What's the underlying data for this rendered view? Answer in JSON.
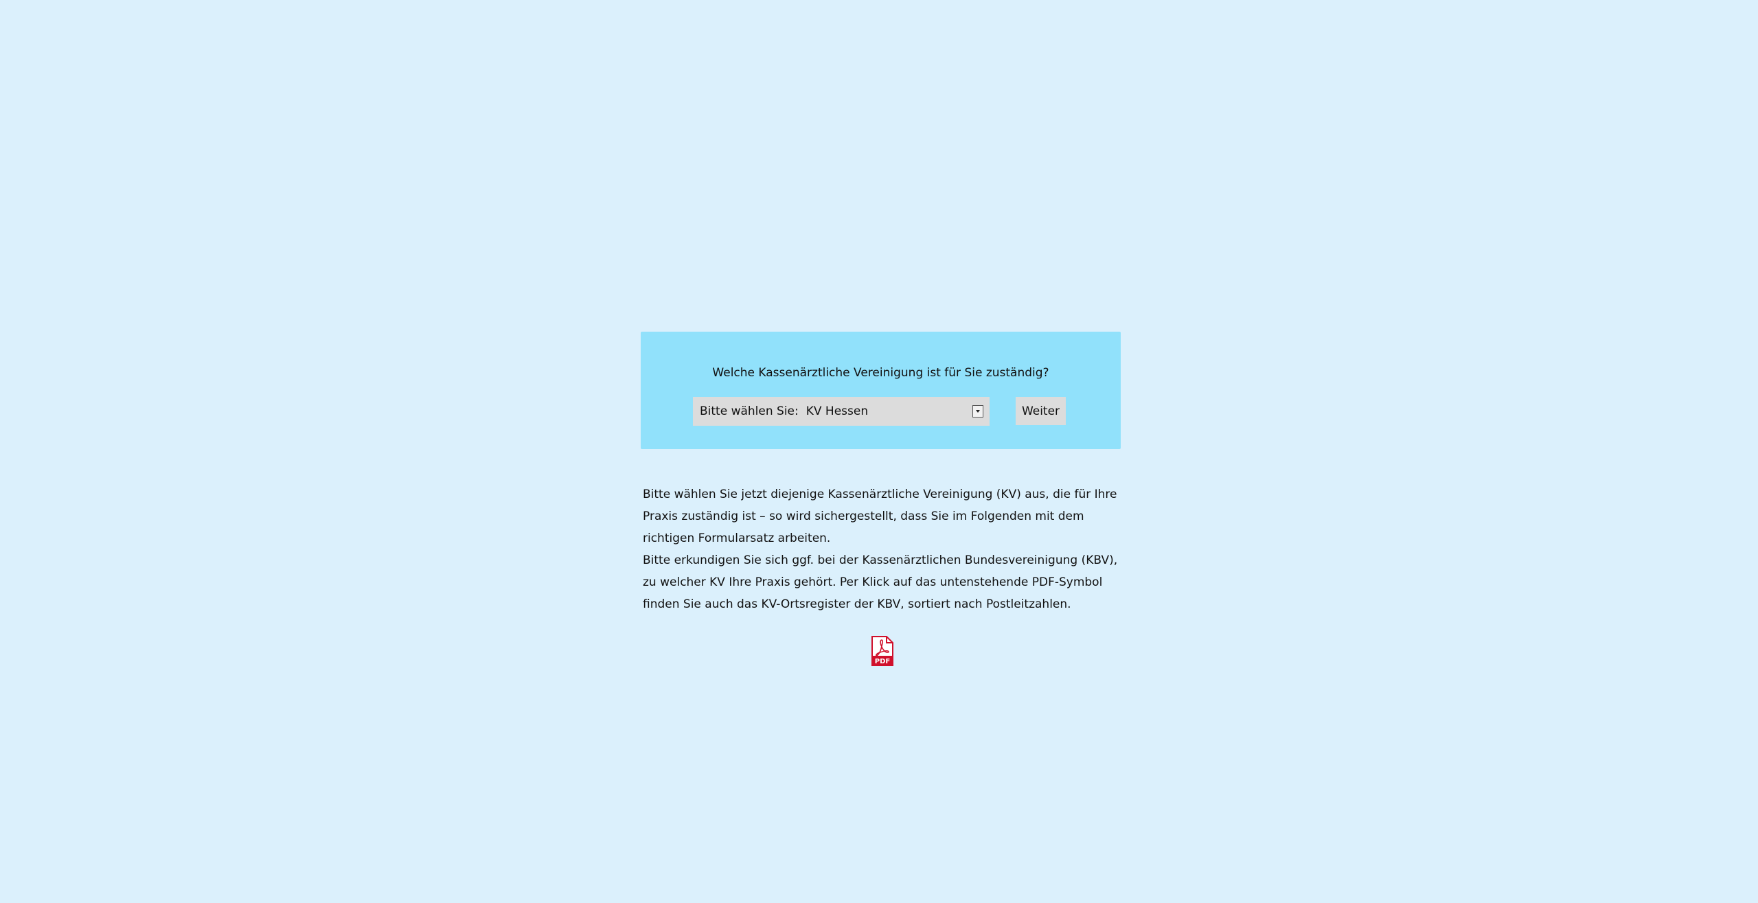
{
  "kv_panel": {
    "question": "Welche Kassenärztliche Vereinigung ist für Sie zuständig?",
    "select_prefix": "Bitte wählen Sie:",
    "select_value": "KV Hessen",
    "weiter_label": "Weiter"
  },
  "info": {
    "paragraph1": "Bitte wählen Sie jetzt diejenige Kassenärztliche Vereinigung (KV) aus, die für Ihre Praxis zuständig ist – so wird sichergestellt, dass Sie im Folgenden mit dem richtigen Formularsatz arbeiten.",
    "paragraph2": "Bitte erkundigen Sie sich ggf. bei der Kassenärztlichen Bundesvereinigung (KBV), zu welcher KV Ihre Praxis gehört. Per Klick auf das untenstehende PDF-Symbol finden Sie auch das KV-Ortsregister der KBV, sortiert nach Postleitzahlen."
  },
  "pdf_icon": {
    "icon": "pdf-icon",
    "label": "PDF",
    "color": "#d0102b"
  },
  "colors": {
    "background": "#dbf0fc",
    "panel": "#91e1fb",
    "control": "#dcdcdc"
  }
}
